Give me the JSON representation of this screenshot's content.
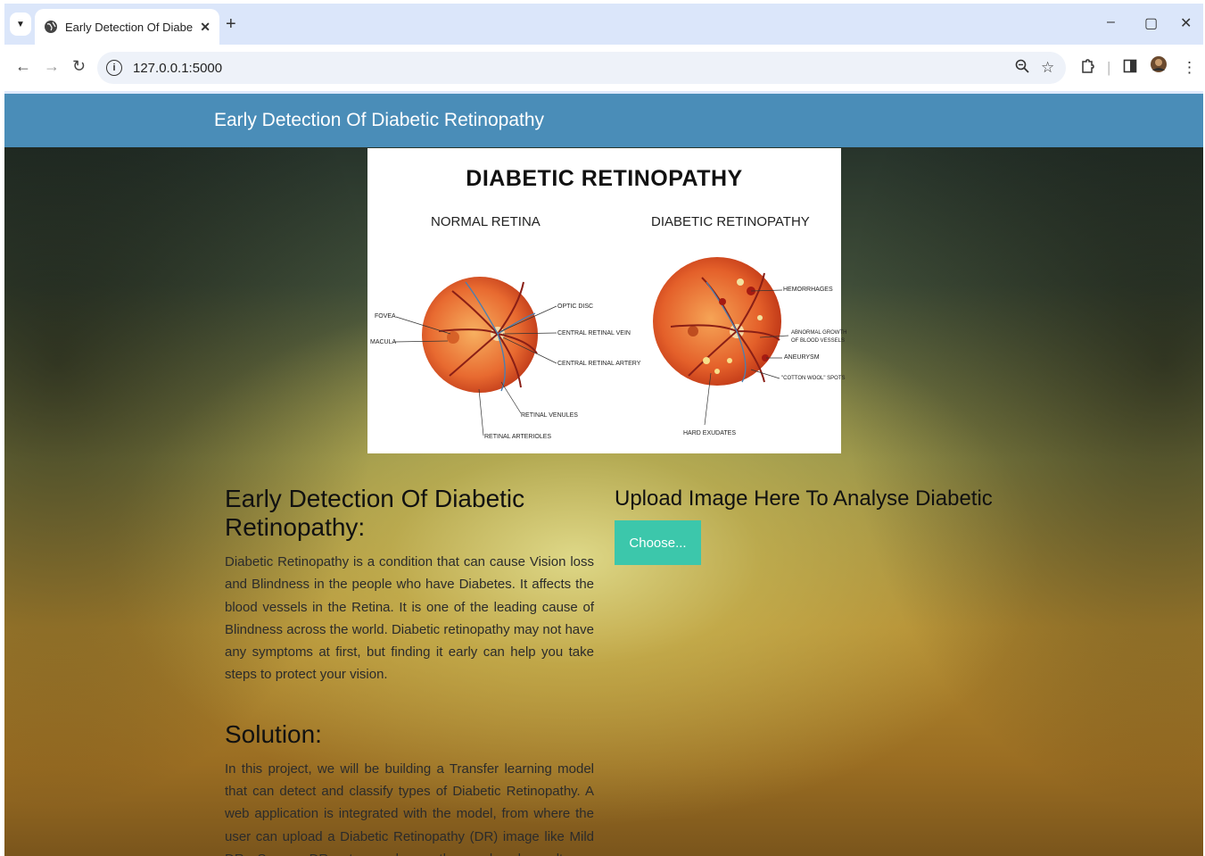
{
  "browser": {
    "tab_title": "Early Detection Of Diabetic Reti",
    "url": "127.0.0.1:5000",
    "tab_menu_icon": "chevron-down-icon",
    "favicon": "globe-icon"
  },
  "header": {
    "brand": "Early Detection Of Diabetic Retinopathy"
  },
  "hero": {
    "title": "DIABETIC RETINOPATHY",
    "normal_label": "NORMAL RETINA",
    "dr_label": "DIABETIC RETINOPATHY",
    "normal_parts": {
      "fovea": "FOVEA",
      "macula": "MACULA",
      "optic_disc": "OPTIC DISC",
      "central_vein": "CENTRAL RETINAL VEIN",
      "central_artery": "CENTRAL RETINAL ARTERY",
      "venules": "RETINAL VENULES",
      "arterioles": "RETINAL ARTERIOLES"
    },
    "dr_parts": {
      "hemorrhages": "HEMORRHAGES",
      "abnormal_growth_1": "ABNORMAL GROWTH",
      "abnormal_growth_2": "OF BLOOD VESSELS",
      "aneurysm": "ANEURYSM",
      "cotton_wool": "\"COTTON WOOL\" SPOTS",
      "hard_exudates": "HARD EXUDATES"
    }
  },
  "intro": {
    "heading": "Early Detection Of Diabetic Retinopathy:",
    "body": "Diabetic Retinopathy is a condition that can cause Vision loss and Blindness in the people who have Diabetes. It affects the blood vessels in the Retina. It is one of the leading cause of Blindness across the world. Diabetic retinopathy may not have any symptoms at first, but finding it early can help you take steps to protect your vision."
  },
  "solution": {
    "heading": "Solution:",
    "body": "In this project, we will be building a Transfer learning model that can detect and classify types of Diabetic Retinopathy. A web application is integrated with the model, from where the user can upload a Diabetic Retinopathy (DR) image like Mild DR, Severe DR, etc., and see the analyzed results on UserInterface."
  },
  "upload": {
    "heading": "Upload Image Here To Analyse Diabetic",
    "button_label": "Choose..."
  },
  "colors": {
    "header_bg": "#4a8db8",
    "button_bg": "#3cc7ab"
  }
}
